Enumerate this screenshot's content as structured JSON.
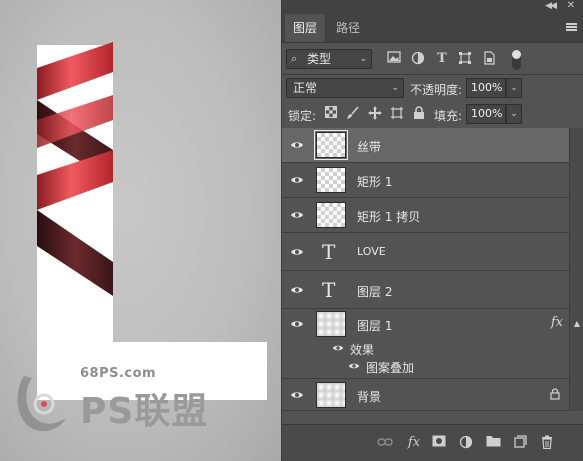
{
  "canvas": {
    "watermark_url": "68PS.com",
    "watermark_brand": "PS联盟"
  },
  "panel": {
    "tabs": [
      {
        "label": "图层",
        "active": true
      },
      {
        "label": "路径",
        "active": false
      }
    ],
    "filter": {
      "kind_label": "类型"
    },
    "blend": {
      "mode": "正常",
      "opacity_label": "不透明度:",
      "opacity_value": "100%"
    },
    "lock": {
      "label": "锁定:",
      "fill_label": "填充:",
      "fill_value": "100%"
    },
    "layers": [
      {
        "name": "丝带",
        "kind": "pixel",
        "selected": true,
        "visible": true
      },
      {
        "name": "矩形 1",
        "kind": "pixel",
        "selected": false,
        "visible": true
      },
      {
        "name": "矩形 1 拷贝",
        "kind": "pixel",
        "selected": false,
        "visible": true
      },
      {
        "name": "LOVE",
        "kind": "text",
        "selected": false,
        "visible": true
      },
      {
        "name": "图层 2",
        "kind": "text",
        "selected": false,
        "visible": true
      },
      {
        "name": "图层 1",
        "kind": "gradient",
        "selected": false,
        "visible": true,
        "fx": "fx",
        "effects_label": "效果",
        "effects": [
          "图案叠加"
        ]
      },
      {
        "name": "背景",
        "kind": "gradient",
        "selected": false,
        "visible": true,
        "locked": true
      }
    ]
  },
  "colors": {
    "panel_bg": "#535353",
    "selected_row": "#676767",
    "ribbon_red": "#e8434a",
    "ribbon_dark": "#3b1518"
  }
}
